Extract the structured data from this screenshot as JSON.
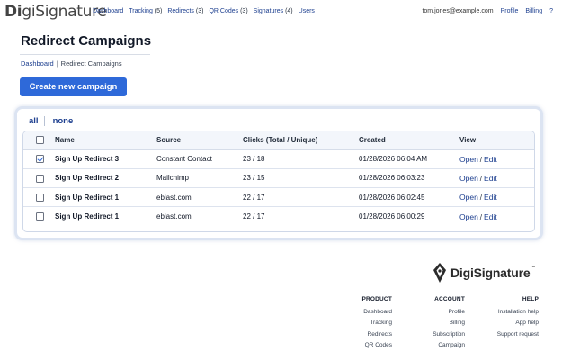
{
  "brand": {
    "prefix": "Di",
    "name": "giSignature"
  },
  "nav": {
    "items": [
      {
        "label": "Dashboard",
        "count": ""
      },
      {
        "label": "Tracking",
        "count": "(5)"
      },
      {
        "label": "Redirects",
        "count": "(3)"
      },
      {
        "label": "QR Codes",
        "count": "(3)"
      },
      {
        "label": "Signatures",
        "count": "(4)"
      },
      {
        "label": "Users",
        "count": ""
      }
    ],
    "email": "tom.jones@example.com",
    "profile": "Profile",
    "billing": "Billing",
    "help": "?"
  },
  "page": {
    "title": "Redirect Campaigns",
    "breadcrumb": {
      "home": "Dashboard",
      "separator": "|",
      "current": "Redirect Campaigns"
    },
    "create_button": "Create new campaign"
  },
  "filters": {
    "all": "all",
    "none": "none"
  },
  "table": {
    "headers": {
      "name": "Name",
      "source": "Source",
      "clicks": "Clicks (Total / Unique)",
      "created": "Created",
      "view": "View"
    },
    "rows": [
      {
        "checked": true,
        "name": "Sign Up Redirect 3",
        "source": "Constant Contact",
        "clicks": "23 / 18",
        "created": "01/28/2026 06:04 AM",
        "open": "Open",
        "edit": "Edit"
      },
      {
        "checked": false,
        "name": "Sign Up Redirect 2",
        "source": "Mailchimp",
        "clicks": "23 / 15",
        "created": "01/28/2026 06:03:23",
        "open": "Open",
        "edit": "Edit"
      },
      {
        "checked": false,
        "name": "Sign Up Redirect 1",
        "source": "eblast.com",
        "clicks": "22 / 17",
        "created": "01/28/2026 06:02:45",
        "open": "Open",
        "edit": "Edit"
      },
      {
        "checked": false,
        "name": "Sign Up Redirect 1",
        "source": "eblast.com",
        "clicks": "22 / 17",
        "created": "01/28/2026 06:00:29",
        "open": "Open",
        "edit": "Edit"
      }
    ],
    "view_separator": "/"
  },
  "footer": {
    "logo_text": "DigiSignature",
    "logo_tm": "™",
    "product": {
      "heading": "PRODUCT",
      "links": [
        "Dashboard",
        "Tracking",
        "Redirects",
        "QR Codes"
      ]
    },
    "account": {
      "heading": "ACCOUNT",
      "links": [
        "Profile",
        "Billing",
        "Subscription",
        "Campaign"
      ]
    },
    "help": {
      "heading": "HELP",
      "links": [
        "Installation help",
        "App help",
        "Support request"
      ]
    }
  },
  "colors": {
    "accent": "#2e69d9",
    "link": "#1d3f8f",
    "card_border": "#dce4f2"
  }
}
